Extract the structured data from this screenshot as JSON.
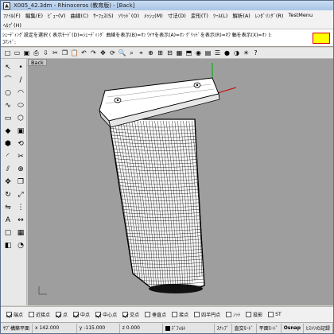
{
  "window": {
    "title": "X005_42.3dm - Rhinoceros (教育版) - [Back]"
  },
  "menus": {
    "row1": [
      "ﾌｧｲﾙ(F)",
      "編集(E)",
      "ﾋﾞｭｰ(V)",
      "曲線(C)",
      "ｻｰﾌｪｽ(S)",
      "ｿﾘｯﾄﾞ(O)",
      "ﾒｯｼｭ(M)",
      "寸法(D)",
      "変形(T)",
      "ﾂｰﾙ(L)",
      "解析(A)",
      "ﾚﾝﾀﾞﾘﾝｸﾞ(R)",
      "TestMenu"
    ],
    "row2": [
      "ﾍﾙﾌﾟ(H)"
    ]
  },
  "command": {
    "history": "ｼｪｰﾃﾞｨﾝｸﾞ設定を選択 ( 表示ﾓｰﾄﾞ(D)=ｼｪｰﾃﾞｨﾝｸﾞ 曲線を表示(B)=ｵﾝ  ﾜｲﾔを表示(A)=ｵﾝ  ｸﾞﾘｯﾄﾞを表示(R)=ｵﾌ  軸を表示(X)=ｵﾝ ):",
    "prompt": "ｺﾏﾝﾄﾞ:"
  },
  "viewport": {
    "label": "Back"
  },
  "icons": {
    "top": [
      "new-icon",
      "open-icon",
      "save-icon",
      "print-icon",
      "import-icon",
      "cut-icon",
      "copy-icon",
      "paste-icon",
      "undo-icon",
      "redo-icon",
      "pan-icon",
      "rotate-icon",
      "zoom-icon",
      "zoom-window-icon",
      "zoom-extents-icon",
      "zoom-selected-icon",
      "fourview-icon",
      "grid-icon",
      "shade-icon",
      "select-icon",
      "render-icon",
      "layer-icon",
      "properties-icon",
      "sphere-icon",
      "material-icon",
      "light-icon",
      "help-icon"
    ],
    "top_glyphs": [
      "□",
      "▭",
      "▣",
      "⎙",
      "⇩",
      "✂",
      "❐",
      "📋",
      "↶",
      "↷",
      "✥",
      "⟳",
      "🔍",
      "⌕",
      "⌖",
      "⊕",
      "⊞",
      "⊟",
      "▦",
      "⬒",
      "◉",
      "▤",
      "☰",
      "●",
      "◑",
      "☀",
      "?"
    ],
    "left": [
      "select-icon",
      "point-icon",
      "polyline-icon",
      "line-icon",
      "circle-icon",
      "arc-icon",
      "curve-icon",
      "ellipse-icon",
      "rectangle-icon",
      "polygon-icon",
      "surface-icon",
      "box-icon",
      "extrude-icon",
      "revolve-icon",
      "fillet-icon",
      "trim-icon",
      "split-icon",
      "join-icon",
      "move-icon",
      "copy-icon",
      "rotate-icon",
      "scale-icon",
      "mirror-icon",
      "array-icon",
      "text-icon",
      "dimension-icon",
      "group-icon",
      "mesh-icon",
      "boolean-icon",
      "analyze-icon"
    ],
    "left_glyphs": [
      "↖",
      "•",
      "⌒",
      "/",
      "○",
      "◠",
      "∿",
      "⬭",
      "▭",
      "⬡",
      "◆",
      "▣",
      "⬢",
      "⟲",
      "◜",
      "✂",
      "⫽",
      "⊕",
      "✥",
      "❐",
      "↻",
      "⤢",
      "⇋",
      "⋮",
      "A",
      "↔",
      "▢",
      "▦",
      "◧",
      "◔"
    ]
  },
  "osnap": [
    {
      "label": "端点",
      "checked": true
    },
    {
      "label": "近接点",
      "checked": false
    },
    {
      "label": "点",
      "checked": true
    },
    {
      "label": "中点",
      "checked": true
    },
    {
      "label": "中心点",
      "checked": true
    },
    {
      "label": "交点",
      "checked": true
    },
    {
      "label": "垂直点",
      "checked": false
    },
    {
      "label": "接点",
      "checked": false
    },
    {
      "label": "四半円点",
      "checked": false
    },
    {
      "label": "ﾉｯﾄ",
      "checked": false
    },
    {
      "label": "投影",
      "checked": false
    },
    {
      "label": "ST",
      "checked": false
    }
  ],
  "status": {
    "cplane": "ｻﾌﾞ構築平面",
    "x": "x 142.000",
    "y": "y -115.000",
    "z": "z 0.000",
    "layer": "ﾃﾞﾌｫﾙﾄ",
    "snap": "ｽﾅｯﾌﾟ",
    "ortho": "直交ﾓｰﾄﾞ",
    "planar": "平面ﾓｰﾄﾞ",
    "osnap": "Osnap",
    "record": "ﾋｽﾄﾘの記録"
  },
  "colors": {
    "viewport_bg": "#9e9e9e",
    "command_input": "#ffff00",
    "axis_x": "#cc0000",
    "axis_y": "#00aa00"
  }
}
